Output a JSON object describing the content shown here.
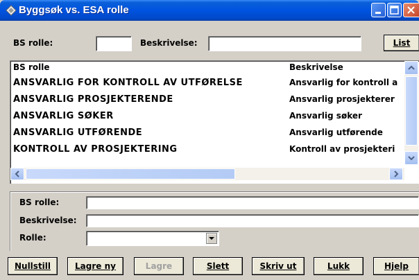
{
  "window": {
    "title": "Byggsøk vs. ESA rolle"
  },
  "search": {
    "bs_rolle_label": "BS rolle:",
    "bs_rolle_value": "",
    "beskrivelse_label": "Beskrivelse:",
    "beskrivelse_value": "",
    "list_button": "List"
  },
  "list": {
    "columns": [
      "BS rolle",
      "Beskrivelse"
    ],
    "rows": [
      {
        "rolle": "ANSVARLIG FOR KONTROLL AV UTFØRELSE",
        "beskrivelse": "Ansvarlig for kontroll a"
      },
      {
        "rolle": "ANSVARLIG PROSJEKTERENDE",
        "beskrivelse": "Ansvarlig prosjekterer"
      },
      {
        "rolle": "ANSVARLIG SØKER",
        "beskrivelse": "Ansvarlig søker"
      },
      {
        "rolle": "ANSVARLIG UTFØRENDE",
        "beskrivelse": "Ansvarlig utførende"
      },
      {
        "rolle": "KONTROLL AV PROSJEKTERING",
        "beskrivelse": "Kontroll av prosjekteri"
      }
    ]
  },
  "detail": {
    "bs_rolle_label": "BS rolle:",
    "bs_rolle_value": "",
    "beskrivelse_label": "Beskrivelse:",
    "beskrivelse_value": "",
    "rolle_label": "Rolle:",
    "rolle_value": ""
  },
  "buttons": {
    "nullstill": "Nullstill",
    "lagre_ny": "Lagre ny",
    "lagre": "Lagre",
    "slett": "Slett",
    "skriv_ut": "Skriv ut",
    "lukk": "Lukk",
    "hjelp": "Hjelp"
  },
  "icons": {
    "app": "diamond-app-icon",
    "minimize": "minimize-icon",
    "maximize": "maximize-icon",
    "close": "close-icon",
    "scroll_up": "arrow-up-icon",
    "scroll_down": "arrow-down-icon",
    "scroll_left": "arrow-left-icon",
    "scroll_right": "arrow-right-icon",
    "dropdown": "dropdown-arrow-icon"
  },
  "colors": {
    "titlebar": "#0053e0",
    "face": "#d4d0c8",
    "button": "#ece9d8"
  }
}
